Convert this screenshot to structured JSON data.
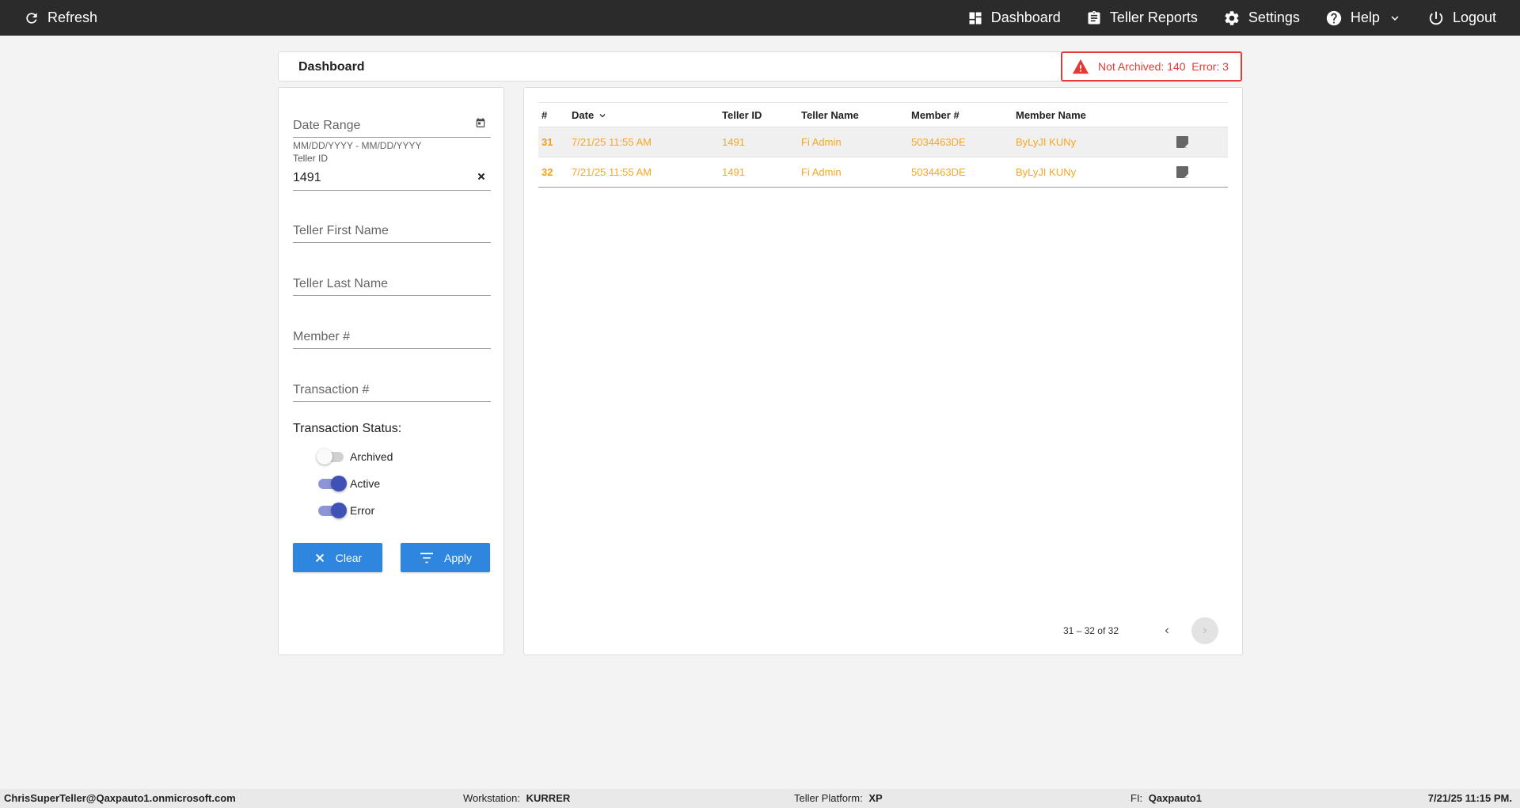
{
  "topbar": {
    "refresh_label": "Refresh",
    "nav": {
      "dashboard": "Dashboard",
      "teller_reports": "Teller Reports",
      "settings": "Settings",
      "help": "Help",
      "logout": "Logout"
    }
  },
  "header": {
    "title": "Dashboard",
    "alert": "Not Archived: 140  Error: 3"
  },
  "filters": {
    "date_range_placeholder": "Date Range",
    "date_range_hint": "MM/DD/YYYY - MM/DD/YYYY",
    "teller_id_label": "Teller ID",
    "teller_id_value": "1491",
    "teller_first_name_placeholder": "Teller First Name",
    "teller_last_name_placeholder": "Teller Last Name",
    "member_num_placeholder": "Member #",
    "transaction_num_placeholder": "Transaction #",
    "status_label": "Transaction Status:",
    "toggles": {
      "archived": {
        "label": "Archived",
        "on": false
      },
      "active": {
        "label": "Active",
        "on": true
      },
      "error": {
        "label": "Error",
        "on": true
      }
    },
    "clear_label": "Clear",
    "apply_label": "Apply"
  },
  "table": {
    "headers": {
      "num": "#",
      "date": "Date",
      "teller_id": "Teller ID",
      "teller_name": "Teller Name",
      "member_num": "Member #",
      "member_name": "Member Name"
    },
    "rows": [
      {
        "num": "31",
        "date": "7/21/25 11:55 AM",
        "teller_id": "1491",
        "teller_name": "Fi Admin",
        "member_num": "5034463DE",
        "member_name": "ByLyJI KUNy"
      },
      {
        "num": "32",
        "date": "7/21/25 11:55 AM",
        "teller_id": "1491",
        "teller_name": "Fi Admin",
        "member_num": "5034463DE",
        "member_name": "ByLyJI KUNy"
      }
    ],
    "paginator": "31 – 32 of 32"
  },
  "footer": {
    "user": "ChrisSuperTeller@Qaxpauto1.onmicrosoft.com",
    "workstation_label": "Workstation:",
    "workstation_value": "KURRER",
    "platform_label": "Teller Platform:",
    "platform_value": "XP",
    "fi_label": "FI:",
    "fi_value": "Qaxpauto1",
    "datetime": "7/21/25 11:15 PM."
  },
  "colors": {
    "topbar": "#2b2b2b",
    "accent_button": "#2e86de",
    "row_text": "#f5a623",
    "alert": "#e53935",
    "toggle_on": "#3f51b5"
  }
}
